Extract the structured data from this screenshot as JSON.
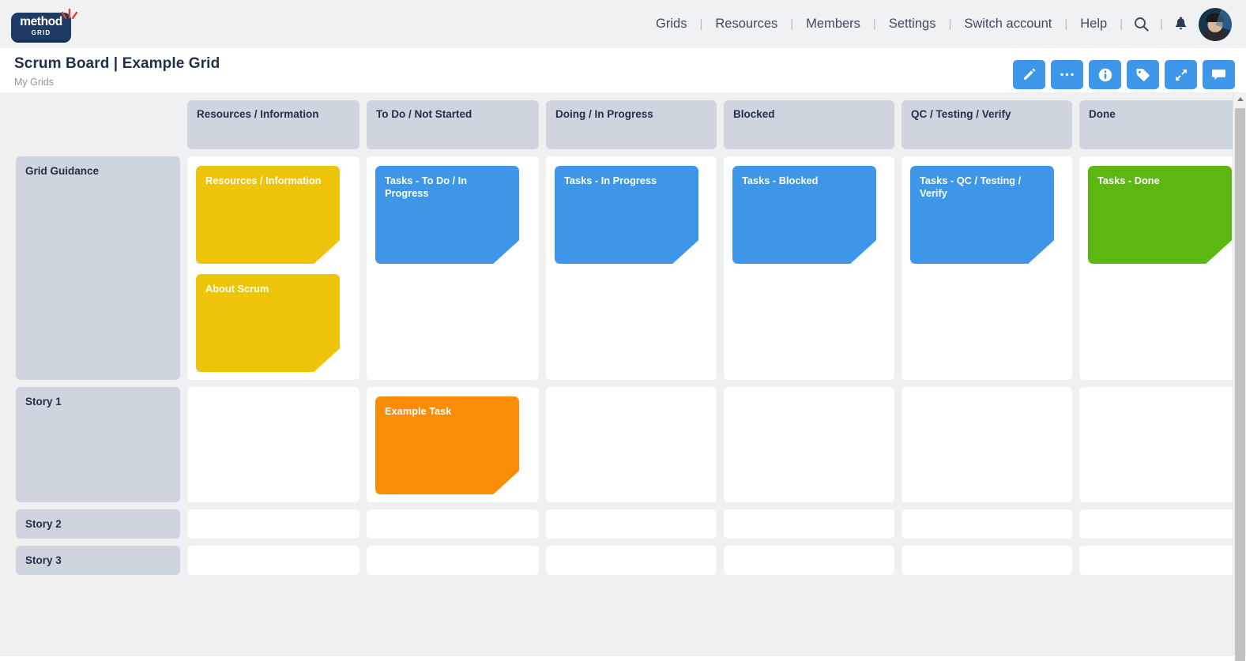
{
  "brand": {
    "logo_line1": "method",
    "logo_line2": "GRID",
    "logo_icon": "spark-icon",
    "navy": "#1f3b63",
    "accent_red": "#e8402a"
  },
  "nav": {
    "items": [
      {
        "label": "Grids"
      },
      {
        "label": "Resources"
      },
      {
        "label": "Members"
      },
      {
        "label": "Settings"
      },
      {
        "label": "Switch account"
      },
      {
        "label": "Help"
      }
    ],
    "separator": "|",
    "search_icon": "search-icon",
    "bell_icon": "bell-icon",
    "avatar_icon": "user-avatar"
  },
  "header": {
    "title": "Scrum Board | Example Grid",
    "breadcrumb": "My Grids"
  },
  "toolbar": {
    "accent": "#3d96e8",
    "buttons": [
      {
        "name": "edit-button",
        "icon": "pencil-icon"
      },
      {
        "name": "more-button",
        "icon": "ellipsis-icon"
      },
      {
        "name": "info-button",
        "icon": "info-icon"
      },
      {
        "name": "tags-button",
        "icon": "tag-icon"
      },
      {
        "name": "expand-button",
        "icon": "expand-arrows-icon"
      },
      {
        "name": "comments-button",
        "icon": "comment-icon"
      }
    ]
  },
  "board": {
    "columns": [
      {
        "label": "Resources / Information"
      },
      {
        "label": "To Do / Not Started"
      },
      {
        "label": "Doing / In Progress"
      },
      {
        "label": "Blocked"
      },
      {
        "label": "QC / Testing / Verify"
      },
      {
        "label": "Done"
      }
    ],
    "rows": [
      {
        "label": "Grid Guidance",
        "type": "guidance",
        "cells": [
          [
            {
              "label": "Resources / Information",
              "color": "yellow"
            },
            {
              "label": "About Scrum",
              "color": "yellow"
            }
          ],
          [
            {
              "label": "Tasks - To Do / In Progress",
              "color": "blue"
            }
          ],
          [
            {
              "label": "Tasks - In Progress",
              "color": "blue"
            }
          ],
          [
            {
              "label": "Tasks - Blocked",
              "color": "blue"
            }
          ],
          [
            {
              "label": "Tasks - QC / Testing / Verify",
              "color": "blue"
            }
          ],
          [
            {
              "label": "Tasks - Done",
              "color": "green"
            }
          ]
        ]
      },
      {
        "label": "Story 1",
        "type": "story",
        "cells": [
          [],
          [
            {
              "label": "Example Task",
              "color": "orange"
            }
          ],
          [],
          [],
          [],
          []
        ]
      },
      {
        "label": "Story 2",
        "type": "story",
        "cells": [
          [],
          [],
          [],
          [],
          [],
          []
        ]
      },
      {
        "label": "Story 3",
        "type": "story",
        "cells": [
          [],
          [],
          [],
          [],
          [],
          []
        ]
      }
    ],
    "card_colors": {
      "yellow": "#edc40a",
      "blue": "#3d96e8",
      "green": "#5cb811",
      "orange": "#f98e06"
    }
  },
  "scrollbar": {
    "up_arrow": "scroll-up-arrow-icon"
  }
}
